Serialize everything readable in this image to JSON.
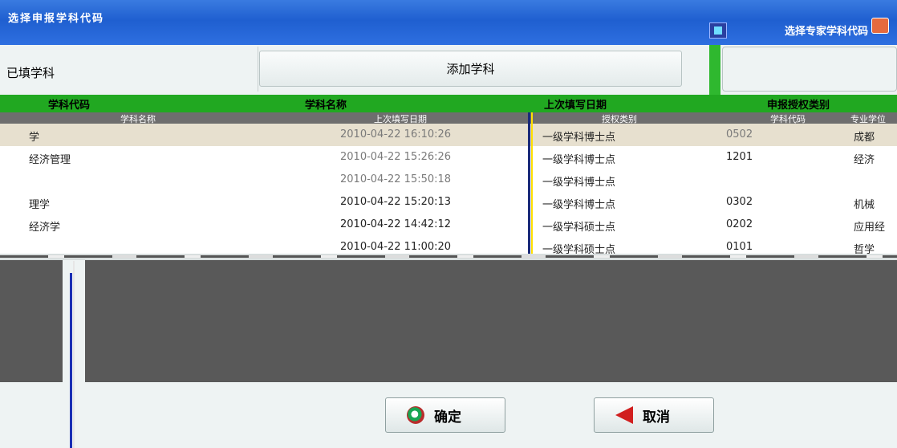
{
  "window": {
    "title": "选择申报学科代码",
    "title2": "选择专家学科代码"
  },
  "left_panel": {
    "tab_label": "已填学科"
  },
  "toolbar": {
    "add_label": "添加学科"
  },
  "back_table": {
    "headers": [
      "学科代码",
      "学科名称",
      "上次填写日期",
      "申报授权类别"
    ]
  },
  "dropdown": {
    "headers": [
      "学科名称",
      "上次填写日期",
      "授权类别",
      "学科代码",
      "专业学位"
    ],
    "rows": [
      {
        "name": "学",
        "date": "2010-04-22 16:10:26",
        "type": "一级学科博士点",
        "code": "0502",
        "extra": "成都"
      },
      {
        "name": "经济管理",
        "date": "2010-04-22 15:26:26",
        "type": "一级学科博士点",
        "code": "1201",
        "extra": "经济"
      },
      {
        "name": "",
        "date": "2010-04-22 15:50:18",
        "type": "一级学科博士点",
        "code": "",
        "extra": ""
      },
      {
        "name": "理学",
        "date": "2010-04-22 15:20:13",
        "type": "一级学科博士点",
        "code": "0302",
        "extra": "机械"
      },
      {
        "name": "经济学",
        "date": "2010-04-22 14:42:12",
        "type": "一级学科硕士点",
        "code": "0202",
        "extra": "应用经"
      },
      {
        "name": "",
        "date": "2010-04-22 11:00:20",
        "type": "一级学科硕士点",
        "code": "0101",
        "extra": "哲学"
      }
    ]
  },
  "buttons": {
    "ok_label": "确定",
    "cancel_label": "取消"
  }
}
